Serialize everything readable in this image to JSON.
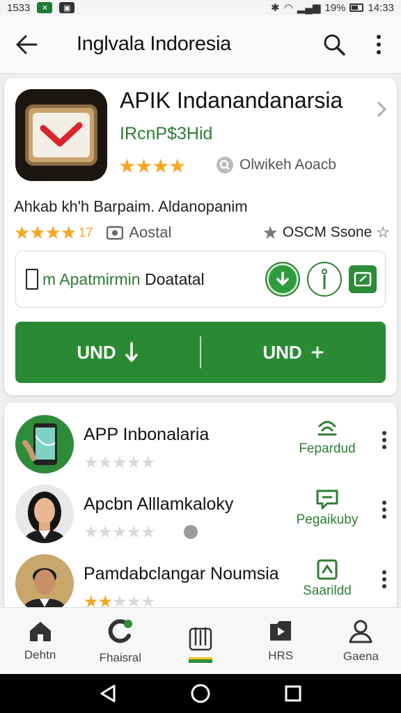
{
  "status_bar": {
    "time_left": "1533",
    "signal_text": "19%",
    "clock": "14:33"
  },
  "app_bar": {
    "title": "Inglvala Indoresia"
  },
  "featured": {
    "name": "APIK Indanandanarsia",
    "developer": "IRcnP$3Hid",
    "stars": "★★★★",
    "meta_text": "Olwikeh Aoacb",
    "description": "Ahkab kh'h Barpaim. Aldanopanim",
    "rating_stars": "★★★★",
    "rating_value": "17",
    "category": "Aostal",
    "score_text": "OSCM Ssone",
    "info_text_green": "m Apatmirmin",
    "info_text_dark": " Doatatal",
    "install_left": "UND",
    "install_right": "UND",
    "colors": {
      "accent": "#2a8a34",
      "star": "#f5a623"
    }
  },
  "list": [
    {
      "title": "APP Inbonalaria",
      "stars_on": "",
      "stars_off": "★★★★★",
      "action_label": "Fepardud",
      "icon": "signal-waves-icon",
      "avatar": "phone-app"
    },
    {
      "title": "Apcbn Alllamkaloky",
      "stars_on": "",
      "stars_off": "★★★★★",
      "action_label": "Pegaikuby",
      "icon": "message-icon",
      "avatar": "woman"
    },
    {
      "title": "Pamdabclangar Noumsia",
      "stars_on": "★★",
      "stars_off": "★★★",
      "action_label": "Saarildd",
      "icon": "upload-box-icon",
      "avatar": "man"
    }
  ],
  "bottom_nav": [
    {
      "label": "Dehtn",
      "icon": "home-icon"
    },
    {
      "label": "Fhaisral",
      "icon": "refresh-icon"
    },
    {
      "label": "",
      "icon": "apps-icon"
    },
    {
      "label": "HRS",
      "icon": "play-folder-icon"
    },
    {
      "label": "Gaena",
      "icon": "person-icon"
    }
  ]
}
